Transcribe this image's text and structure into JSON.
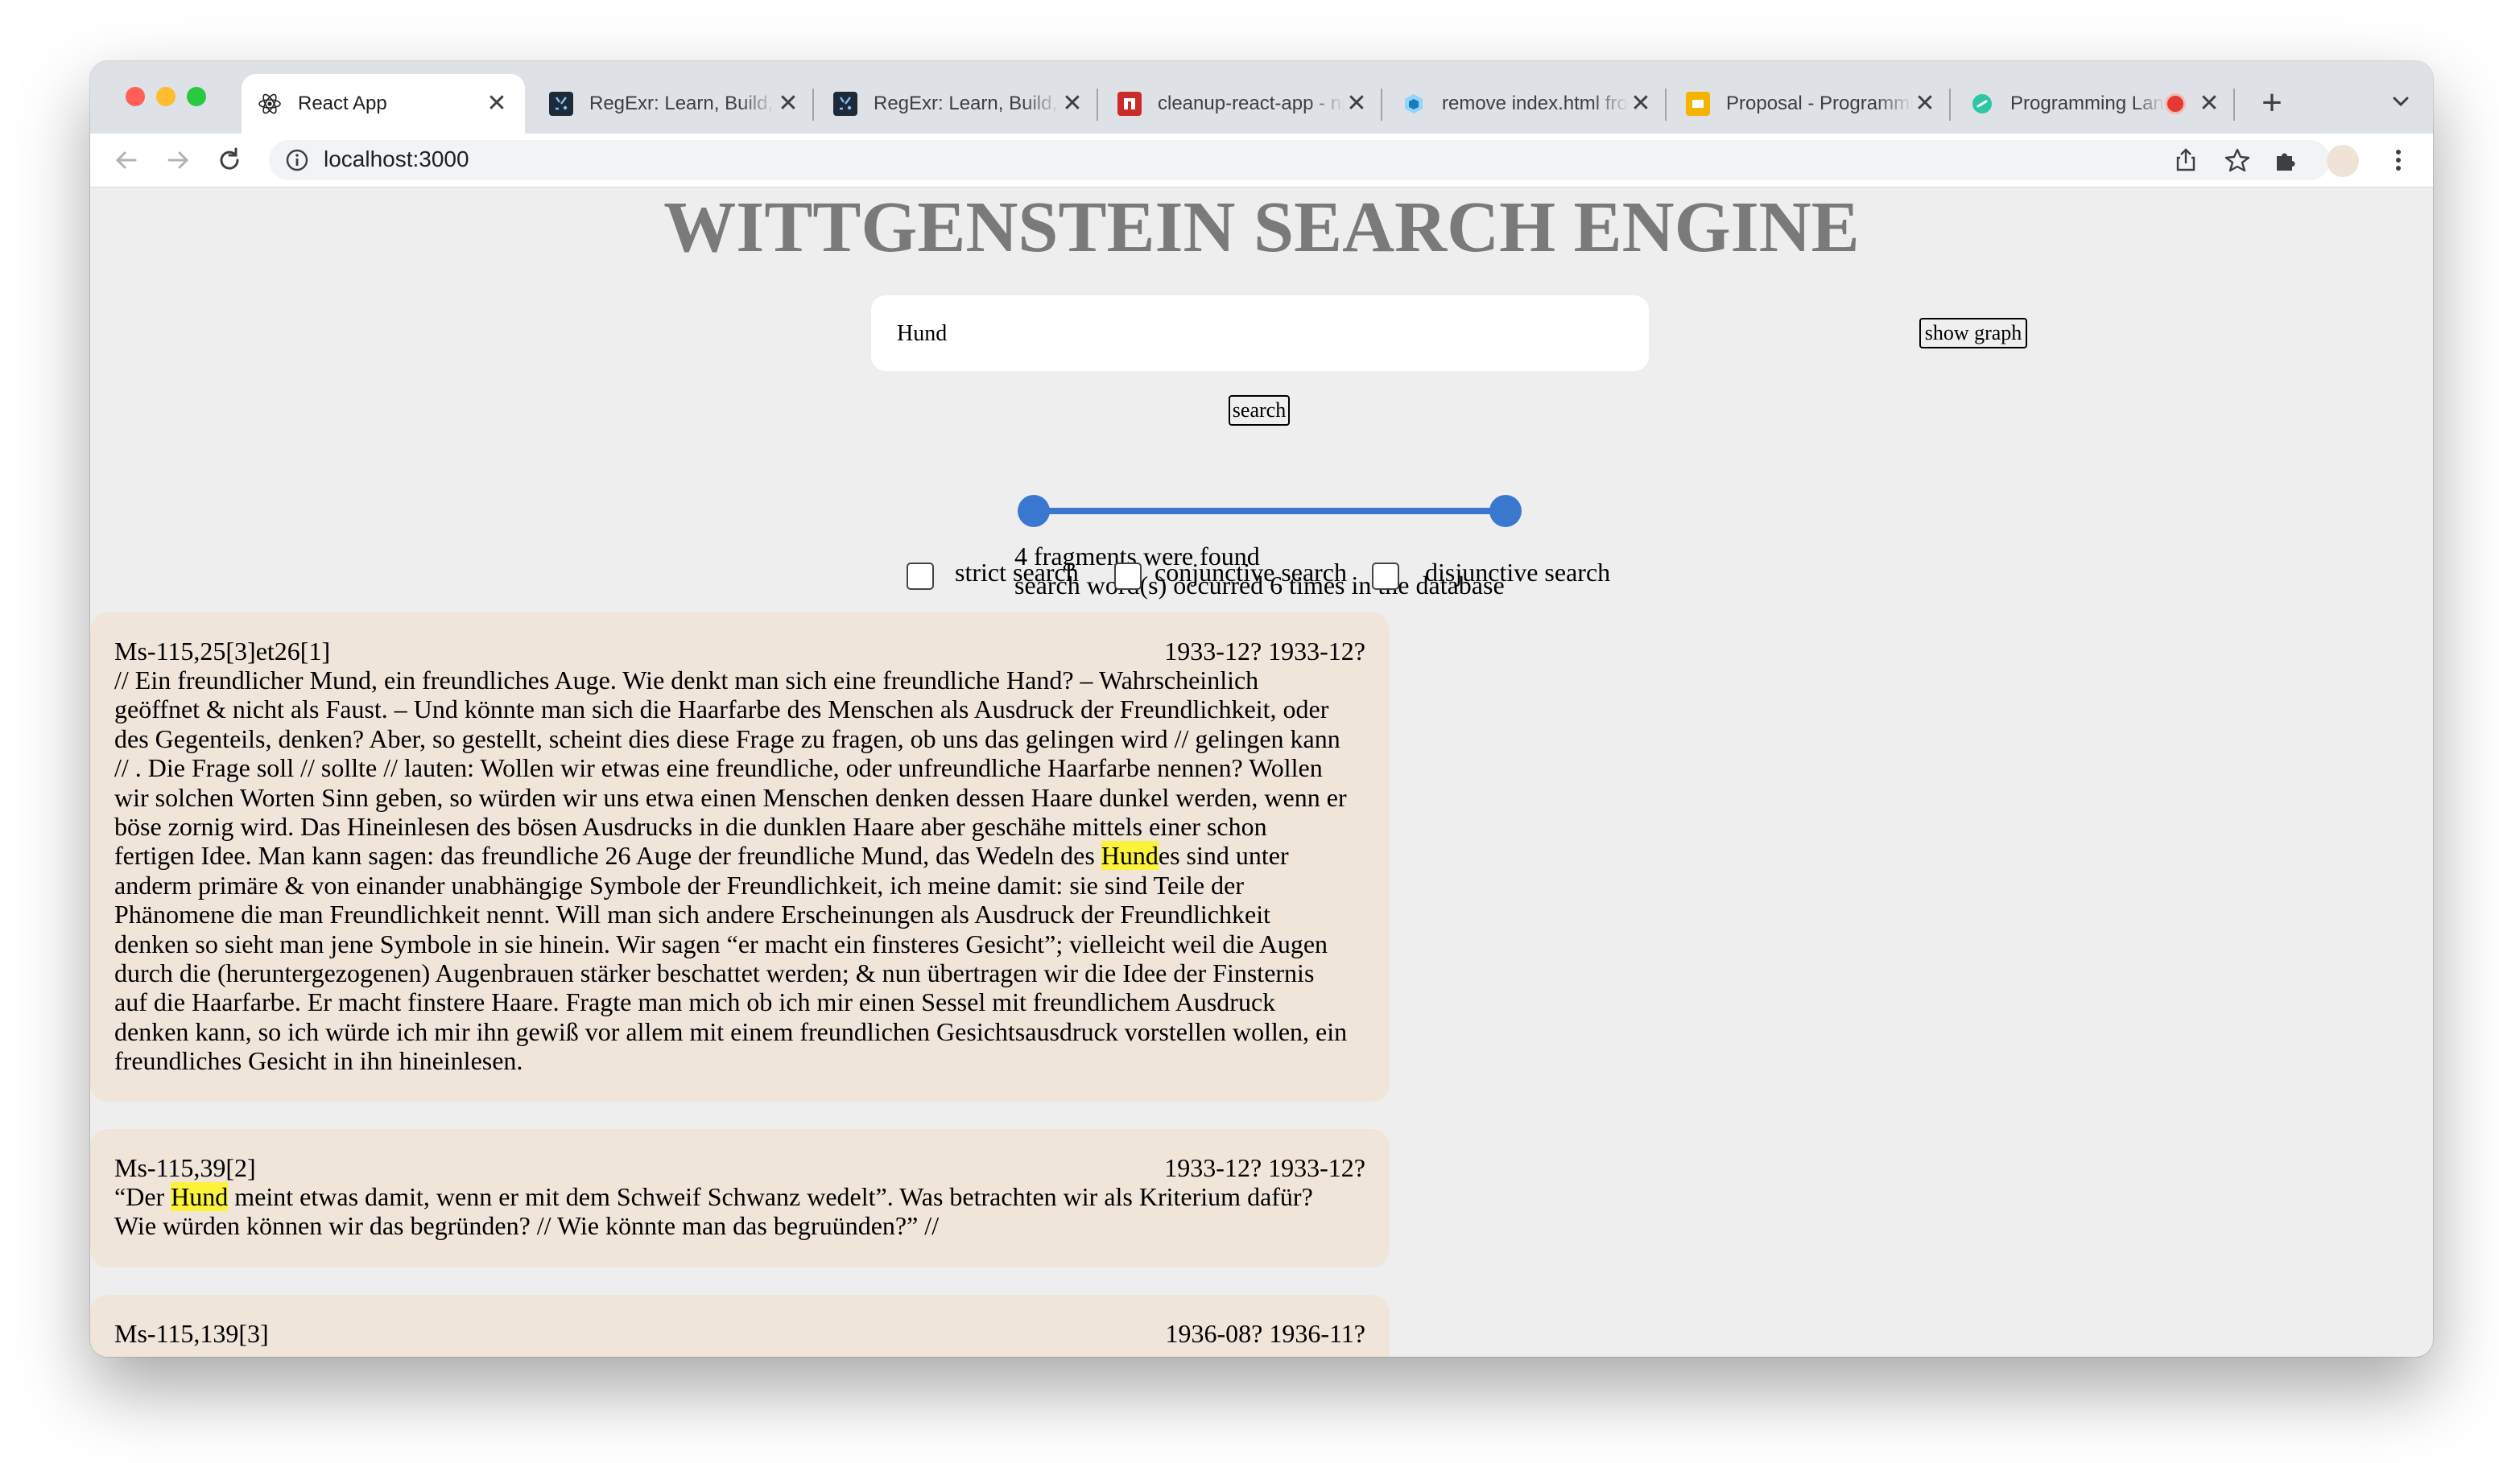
{
  "browser": {
    "tabs": [
      {
        "title": "React App",
        "favicon": "react-icon",
        "active": true
      },
      {
        "title": "RegExr: Learn, Build, & Test RegEx",
        "favicon": "regexr-icon"
      },
      {
        "title": "RegExr: Learn, Build, & Test RegEx",
        "favicon": "regexr-icon"
      },
      {
        "title": "cleanup-react-app - npm",
        "favicon": "npm-icon"
      },
      {
        "title": "remove index.html from url",
        "favicon": "webpack-icon"
      },
      {
        "title": "Proposal - Programming",
        "favicon": "slides-icon"
      },
      {
        "title": "Programming Languages",
        "favicon": "link-icon",
        "recording": true
      }
    ],
    "close_glyph": "✕",
    "new_tab_glyph": "+",
    "url": "localhost:3000"
  },
  "page": {
    "title": "WITTGENSTEIN SEARCH ENGINE",
    "search_value": "Hund",
    "show_graph_label": "show graph",
    "search_label": "search",
    "slider": {
      "low": 0,
      "high": 1
    },
    "results_line1": "4 fragments were found",
    "results_line2": "search word(s) occurred 6 times in the database",
    "options": [
      {
        "label": "strict search",
        "checked": false
      },
      {
        "label": "conjunctive search",
        "checked": false
      },
      {
        "label": "disjunctive search",
        "checked": false
      }
    ]
  },
  "fragments": [
    {
      "id": "Ms-115,25[3]et26[1]",
      "dates": "1933-12? 1933-12?",
      "lines": [
        [
          "// Ein freundlicher Mund, ein freundliches Auge. Wie denkt man sich eine freundliche Hand? – Wahrscheinlich"
        ],
        [
          "geöffnet & nicht als Faust. – Und könnte man sich die Haarfarbe des Menschen als Ausdruck der Freundlichkeit, oder"
        ],
        [
          "des Gegenteils, denken? Aber, so gestellt, scheint dies diese Frage zu fragen, ob uns das gelingen wird // gelingen kann"
        ],
        [
          "// . Die Frage soll // sollte // lauten: Wollen wir etwas eine freundliche, oder unfreundliche Haarfarbe nennen? Wollen"
        ],
        [
          "wir solchen Worten Sinn geben, so würden wir uns etwa einen Menschen denken dessen Haare dunkel werden, wenn er"
        ],
        [
          "böse zornig wird. Das Hineinlesen des bösen Ausdrucks in die dunklen Haare aber geschähe mittels einer schon"
        ],
        [
          "fertigen Idee. Man kann sagen: das freundliche 26 Auge der freundliche Mund, das Wedeln des ",
          "Hund",
          "es sind unter"
        ],
        [
          "anderm primäre & von einander unabhängige Symbole der Freundlichkeit, ich meine damit: sie sind Teile der"
        ],
        [
          "Phänomene die man Freundlichkeit nennt. Will man sich andere Erscheinungen als Ausdruck der Freundlichkeit"
        ],
        [
          "denken so sieht man jene Symbole in sie hinein. Wir sagen “er macht ein finsteres Gesicht”; vielleicht weil die Augen"
        ],
        [
          "durch die (heruntergezogenen) Augenbrauen stärker beschattet werden; & nun übertragen wir die Idee der Finsternis"
        ],
        [
          "auf die Haarfarbe. Er macht finstere Haare. Fragte man mich ob ich mir einen Sessel mit freundlichem Ausdruck"
        ],
        [
          "denken kann, so ich würde ich mir ihn gewiß vor allem mit einem freundlichen Gesichtsausdruck vorstellen wollen, ein"
        ],
        [
          "freundliches Gesicht in ihn hineinlesen."
        ]
      ]
    },
    {
      "id": "Ms-115,39[2]",
      "dates": "1933-12? 1933-12?",
      "lines": [
        [
          "“Der ",
          "Hund",
          " meint etwas damit, wenn er mit dem Schweif Schwanz wedelt”. Was betrachten wir als Kriterium dafür?"
        ],
        [
          "Wie würden können wir das begründen? // Wie könnte man das begruünden?” //"
        ]
      ]
    },
    {
      "id": "Ms-115,139[3]",
      "dates": "1936-08? 1936-11?",
      "lines": []
    }
  ]
}
